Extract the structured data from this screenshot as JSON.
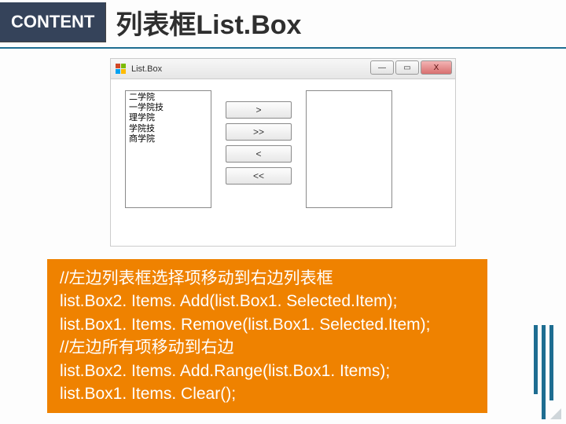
{
  "header": {
    "badge": "CONTENT",
    "title": "列表框List.Box"
  },
  "window": {
    "title": "List.Box",
    "controls": {
      "min": "—",
      "max": "▭",
      "close": "X"
    },
    "left_items": [
      "二学院",
      "一学院技",
      "理学院",
      "学院技",
      "商学院"
    ],
    "buttons": {
      "one_right": ">",
      "all_right": ">>",
      "one_left": "<",
      "all_left": "<<"
    }
  },
  "code": {
    "l1": "//左边列表框选择项移动到右边列表框",
    "l2": "list.Box2. Items. Add(list.Box1. Selected.Item);",
    "l3": "list.Box1. Items. Remove(list.Box1. Selected.Item);",
    "l4": " //左边所有项移动到右边",
    "l5": "list.Box2. Items. Add.Range(list.Box1. Items);",
    "l6": "list.Box1. Items. Clear();"
  }
}
